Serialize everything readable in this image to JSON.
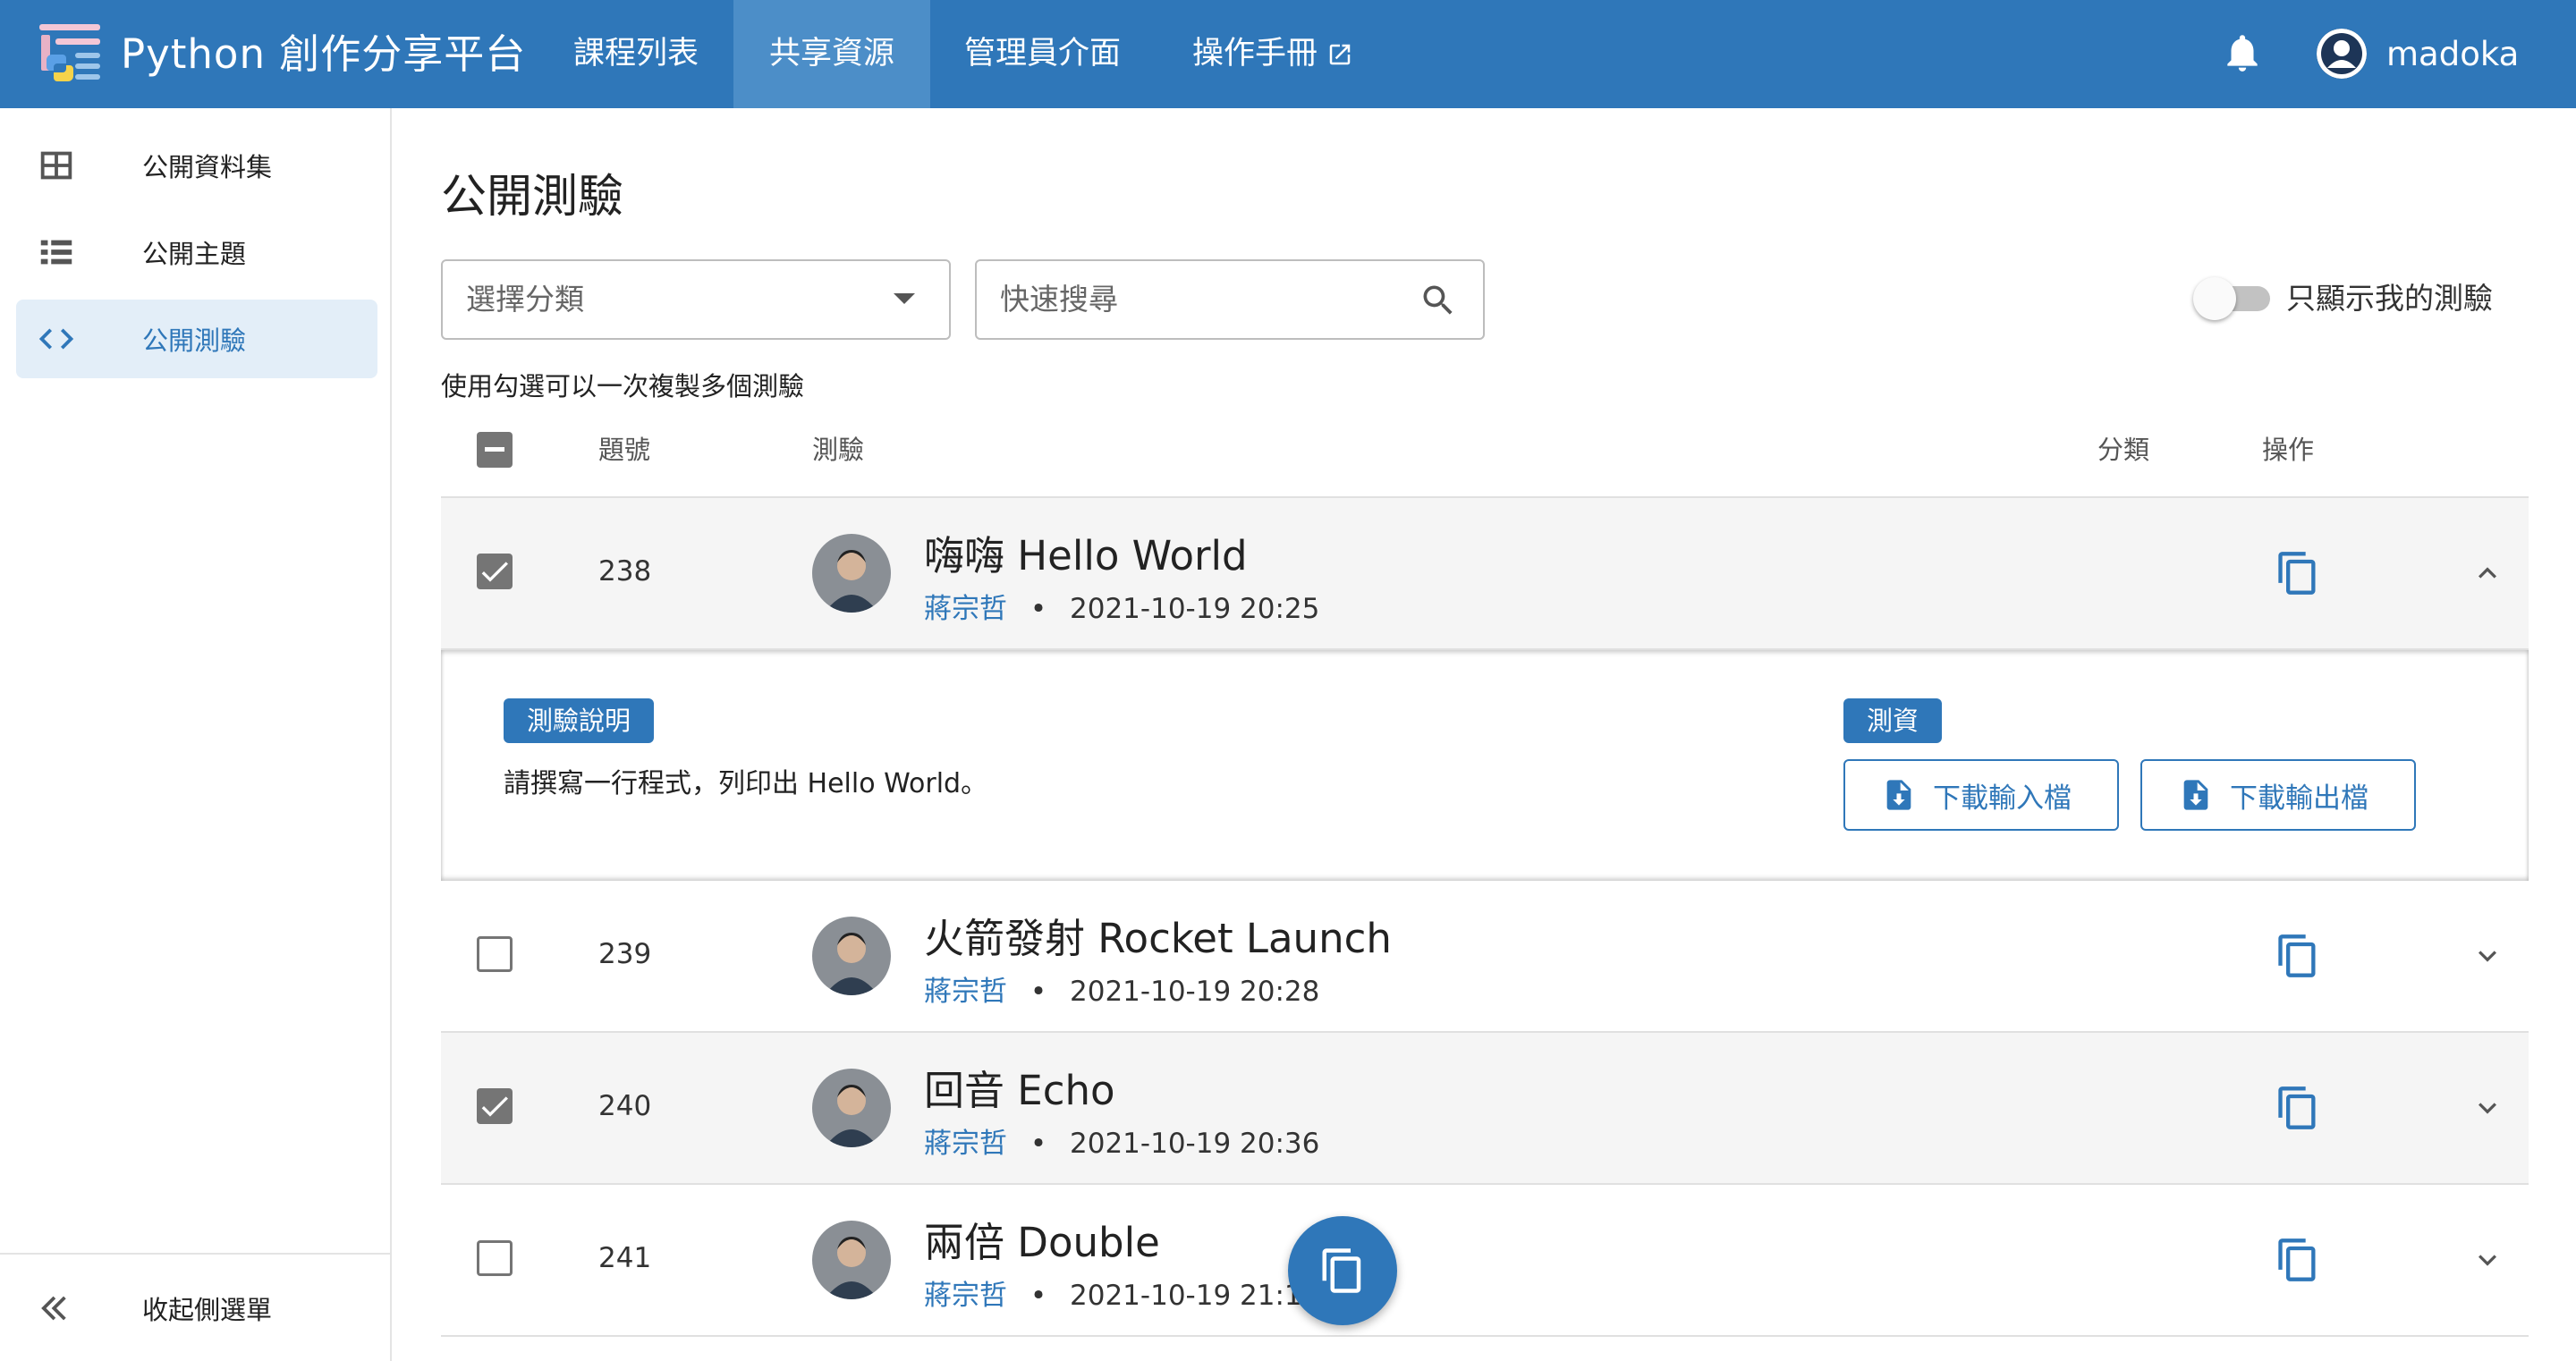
{
  "topbar": {
    "brand": "Python 創作分享平台",
    "nav": [
      {
        "label": "課程列表"
      },
      {
        "label": "共享資源"
      },
      {
        "label": "管理員介面"
      },
      {
        "label": "操作手冊"
      }
    ],
    "username": "madoka",
    "colors": {
      "bar": "#2f77b9",
      "active": "#4c8ec8"
    }
  },
  "sidebar": {
    "items": [
      {
        "label": "公開資料集",
        "icon": "table-icon"
      },
      {
        "label": "公開主題",
        "icon": "list-icon"
      },
      {
        "label": "公開測驗",
        "icon": "code-icon"
      }
    ],
    "collapse_label": "收起側選單"
  },
  "main": {
    "title": "公開測驗",
    "category_placeholder": "選擇分類",
    "search_placeholder": "快速搜尋",
    "toggle_label": "只顯示我的測驗",
    "hint": "使用勾選可以一次複製多個測驗",
    "headers": {
      "num": "題號",
      "quiz": "測驗",
      "category": "分類",
      "action": "操作"
    },
    "rows": [
      {
        "num": "238",
        "title": "嗨嗨 Hello World",
        "author": "蔣宗哲",
        "sep": "•",
        "date": "2021-10-19 20:25",
        "checked": true,
        "expanded": true
      },
      {
        "num": "239",
        "title": "火箭發射 Rocket Launch",
        "author": "蔣宗哲",
        "sep": "•",
        "date": "2021-10-19 20:28",
        "checked": false,
        "expanded": false
      },
      {
        "num": "240",
        "title": "回音 Echo",
        "author": "蔣宗哲",
        "sep": "•",
        "date": "2021-10-19 20:36",
        "checked": true,
        "expanded": false
      },
      {
        "num": "241",
        "title": "兩倍 Double",
        "author": "蔣宗哲",
        "sep": "•",
        "date": "2021-10-19 21:10",
        "checked": false,
        "expanded": false
      }
    ],
    "detail": {
      "desc_chip": "測驗說明",
      "description": "請撰寫一行程式，列印出 Hello World。",
      "data_chip": "測資",
      "download_input": "下載輸入檔",
      "download_output": "下載輸出檔"
    }
  }
}
